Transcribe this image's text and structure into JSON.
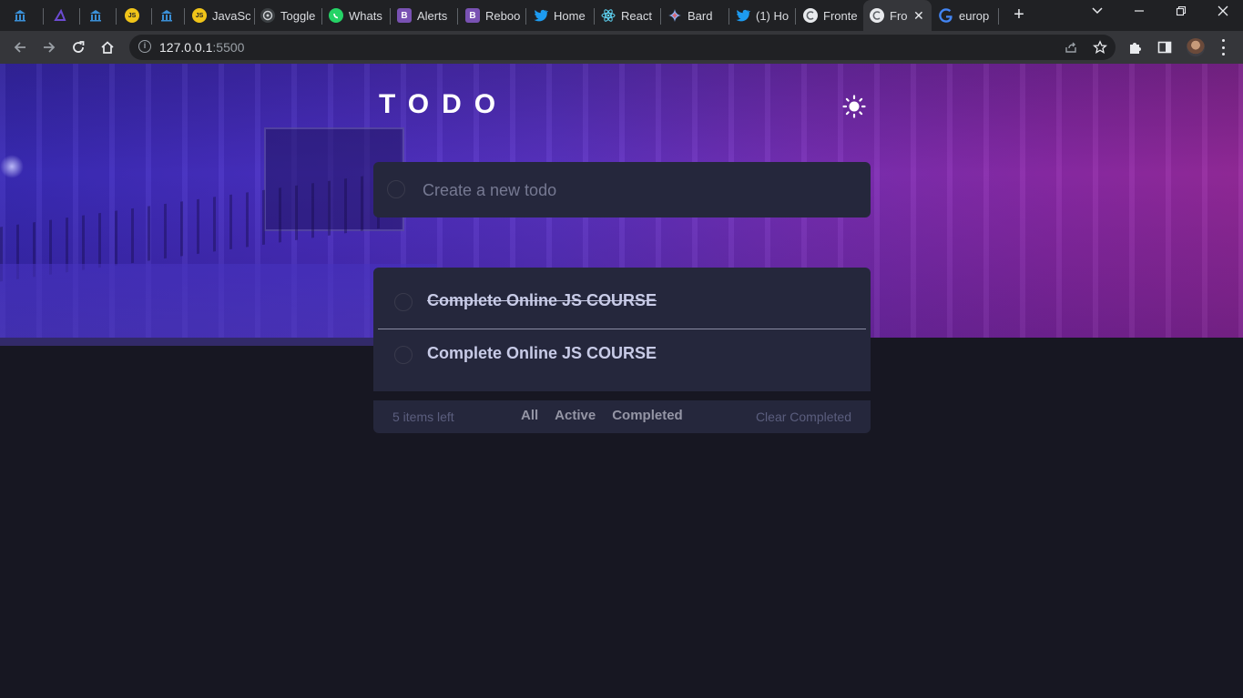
{
  "browser": {
    "tabs": [
      {
        "title": "",
        "icon": "bank-icon",
        "color": "#3a8fd6"
      },
      {
        "title": "",
        "icon": "azure-icon",
        "color": "#6c4bd1"
      },
      {
        "title": "",
        "icon": "bank-icon",
        "color": "#3a8fd6"
      },
      {
        "title": "",
        "icon": "js-icon",
        "color": "#f0c419"
      },
      {
        "title": "",
        "icon": "bank-icon",
        "color": "#3a8fd6"
      },
      {
        "title": "JavaSc",
        "icon": "js-icon",
        "color": "#f0c419"
      },
      {
        "title": "Toggle",
        "icon": "chatgpt-icon",
        "color": "#9aa0a6"
      },
      {
        "title": "Whats",
        "icon": "whatsapp-icon",
        "color": "#25d366"
      },
      {
        "title": "Alerts",
        "icon": "bootstrap-icon",
        "color": "#7952b3"
      },
      {
        "title": "Reboo",
        "icon": "bootstrap-icon",
        "color": "#7952b3"
      },
      {
        "title": "Home",
        "icon": "twitter-icon",
        "color": "#1d9bf0"
      },
      {
        "title": "React",
        "icon": "react-icon",
        "color": "#61dafb"
      },
      {
        "title": "Bard",
        "icon": "bard-icon",
        "color": "#8ab4f8"
      },
      {
        "title": "(1) Ho",
        "icon": "twitter-icon",
        "color": "#1d9bf0"
      },
      {
        "title": "Fronte",
        "icon": "frontend-icon",
        "color": "#e8eaed"
      },
      {
        "title": "Fro",
        "icon": "frontend-icon",
        "color": "#e8eaed"
      },
      {
        "title": "europ",
        "icon": "google-icon",
        "color": "#4285f4"
      }
    ],
    "address": {
      "host": "127.0.0.1",
      "port": ":5500"
    }
  },
  "app": {
    "title": "TODO",
    "theme_toggle_icon": "sun-icon",
    "new_todo_placeholder": "Create a new todo",
    "todos": [
      {
        "text": "Complete Online JS COURSE",
        "completed": true
      },
      {
        "text": "Complete Online JS COURSE",
        "completed": false
      }
    ],
    "footer": {
      "items_left": "5 items left",
      "filters": [
        "All",
        "Active",
        "Completed"
      ],
      "clear_label": "Clear Completed"
    }
  },
  "colors": {
    "background": "#171722",
    "card": "#25273c",
    "todo_text": "#c8cbe7",
    "muted": "#5b5e7e"
  }
}
